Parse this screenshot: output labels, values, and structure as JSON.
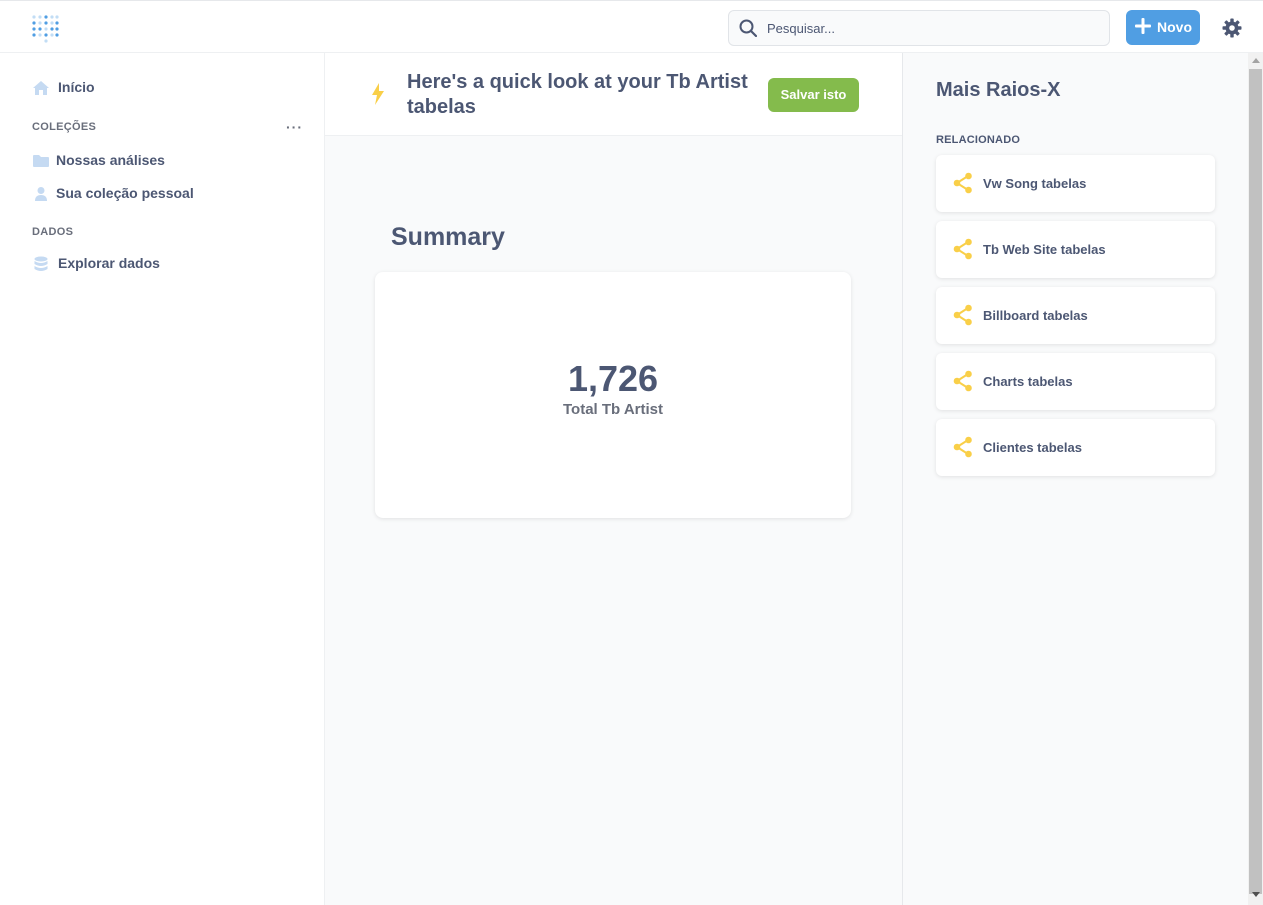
{
  "topbar": {
    "logo_icon": "metabase-logo-icon",
    "search": {
      "placeholder": "Pesquisar...",
      "icon": "search-icon"
    },
    "new_button": {
      "label": "Novo",
      "icon": "plus-icon"
    },
    "settings_icon": "gear-icon"
  },
  "sidebar": {
    "home": {
      "label": "Início",
      "icon": "home-icon"
    },
    "collections": {
      "heading": "COLEÇÕES",
      "more_label": "···",
      "items": [
        {
          "label": "Nossas análises",
          "icon": "folder-icon"
        },
        {
          "label": "Sua coleção pessoal",
          "icon": "person-icon"
        }
      ]
    },
    "data": {
      "heading": "DADOS",
      "items": [
        {
          "label": "Explorar dados",
          "icon": "database-icon"
        }
      ]
    }
  },
  "main": {
    "title": "Here's a quick look at your Tb Artist tabelas",
    "save_label": "Salvar isto",
    "bolt_icon": "bolt-icon",
    "summary_heading": "Summary",
    "scalar": {
      "value": "1,726",
      "label": "Total Tb Artist"
    }
  },
  "right_panel": {
    "title": "Mais Raios-X",
    "section_heading": "RELACIONADO",
    "items": [
      {
        "label": "Vw Song tabelas",
        "icon": "connections-icon"
      },
      {
        "label": "Tb Web Site tabelas",
        "icon": "connections-icon"
      },
      {
        "label": "Billboard tabelas",
        "icon": "connections-icon"
      },
      {
        "label": "Charts tabelas",
        "icon": "connections-icon"
      },
      {
        "label": "Clientes tabelas",
        "icon": "connections-icon"
      }
    ]
  },
  "colors": {
    "brand": "#509ee3",
    "save_green": "#84bb4c",
    "text": "#4c5773",
    "related_icon": "#f9cf48",
    "bolt": "#f9cf48"
  }
}
